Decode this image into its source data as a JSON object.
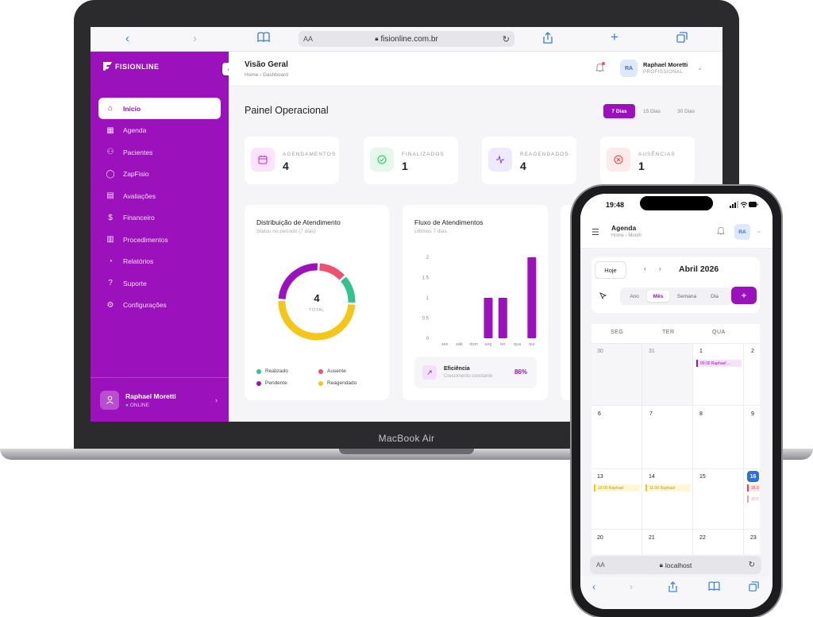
{
  "device": {
    "laptop_label": "MacBook Air"
  },
  "browser": {
    "text_size": "AA",
    "url": "fisionline.com.br"
  },
  "sidebar": {
    "brand": "FISIONLINE",
    "items": [
      {
        "label": "Início",
        "icon": "home-icon"
      },
      {
        "label": "Agenda",
        "icon": "calendar-icon"
      },
      {
        "label": "Pacientes",
        "icon": "users-icon"
      },
      {
        "label": "ZapFisio",
        "icon": "chat-icon"
      },
      {
        "label": "Avaliações",
        "icon": "clipboard-icon"
      },
      {
        "label": "Financeiro",
        "icon": "dollar-icon"
      },
      {
        "label": "Procedimentos",
        "icon": "document-icon"
      },
      {
        "label": "Relatórios",
        "icon": "pie-chart-icon"
      },
      {
        "label": "Suporte",
        "icon": "help-icon"
      },
      {
        "label": "Configurações",
        "icon": "gear-icon"
      }
    ],
    "user": {
      "name": "Raphael Moretti",
      "status": "ONLINE"
    }
  },
  "topbar": {
    "title": "Visão Geral",
    "breadcrumb": "Home  ›  Dashboard",
    "avatar": "RA",
    "user_name": "Raphael Moretti",
    "user_role": "PROFISSIONAL"
  },
  "panel": {
    "title": "Painel Operacional",
    "ranges": [
      "7 Dias",
      "15 Dias",
      "30 Dias"
    ],
    "selected_range": "7 Dias"
  },
  "stats": [
    {
      "label": "AGENDAMENTOS",
      "value": "4",
      "color": "#c026d3"
    },
    {
      "label": "FINALIZADOS",
      "value": "1",
      "color": "#22c55e"
    },
    {
      "label": "REAGENDADOS",
      "value": "4",
      "color": "#7c3aed"
    },
    {
      "label": "AUSÊNCIAS",
      "value": "1",
      "color": "#ef4444"
    }
  ],
  "distribution": {
    "title": "Distribuição de Atendimento",
    "subtitle": "Status no período (7 dias)",
    "total": "4",
    "total_label": "TOTAL",
    "legend": [
      {
        "label": "Realizado",
        "color": "#34c38f"
      },
      {
        "label": "Ausente",
        "color": "#f0506e"
      },
      {
        "label": "Pendente",
        "color": "#9b12bc"
      },
      {
        "label": "Reagendado",
        "color": "#f5c518"
      }
    ]
  },
  "flow": {
    "title": "Fluxo de Atendimentos",
    "subtitle": "Últimos 7 dias",
    "efficiency_label": "Eficiência",
    "efficiency_sub": "Crescimento constante",
    "efficiency_value": "86%"
  },
  "chart_data": {
    "type": "bar",
    "categories": [
      "sex",
      "sáb",
      "dom",
      "seg",
      "ter",
      "qua",
      "qui"
    ],
    "values": [
      0,
      0,
      0,
      1,
      1,
      0,
      2
    ],
    "yticks": [
      "0",
      "0.5",
      "1",
      "1.5",
      "2"
    ],
    "ylim": [
      0,
      2
    ],
    "color": "#9b12bc"
  },
  "donut_data": {
    "segments": [
      {
        "label": "Ausente",
        "value": 0.5,
        "color": "#f0506e"
      },
      {
        "label": "Realizado",
        "value": 0.5,
        "color": "#34c38f"
      },
      {
        "label": "Reagendado",
        "value": 2,
        "color": "#f5c518"
      },
      {
        "label": "Pendente",
        "value": 1,
        "color": "#9b12bc"
      }
    ]
  },
  "phone": {
    "time": "19:48",
    "title": "Agenda",
    "breadcrumb": "Home  ›  Month",
    "avatar": "RA",
    "today": "Hoje",
    "month": "Abril 2026",
    "views": [
      "Ano",
      "Mês",
      "Semana",
      "Dia"
    ],
    "active_view": "Mês",
    "weekdays": [
      "SEG",
      "TER",
      "QUA"
    ],
    "rows": [
      [
        "30",
        "31",
        "1",
        "2"
      ],
      [
        "6",
        "7",
        "8",
        "9"
      ],
      [
        "13",
        "14",
        "15",
        "16"
      ],
      [
        "20",
        "21",
        "22",
        "23"
      ]
    ],
    "events": [
      {
        "text": "09:30  Raphael ...",
        "color": "#9b12bc"
      },
      {
        "text": "19:00  Raphael",
        "color": "#f5c518"
      },
      {
        "text": "11:00  Raphael",
        "color": "#f5c518"
      },
      {
        "text": "15:3",
        "color": "#ef4444"
      },
      {
        "text": "15:5",
        "color": "#f0a0aa"
      }
    ],
    "url": "localhost"
  }
}
